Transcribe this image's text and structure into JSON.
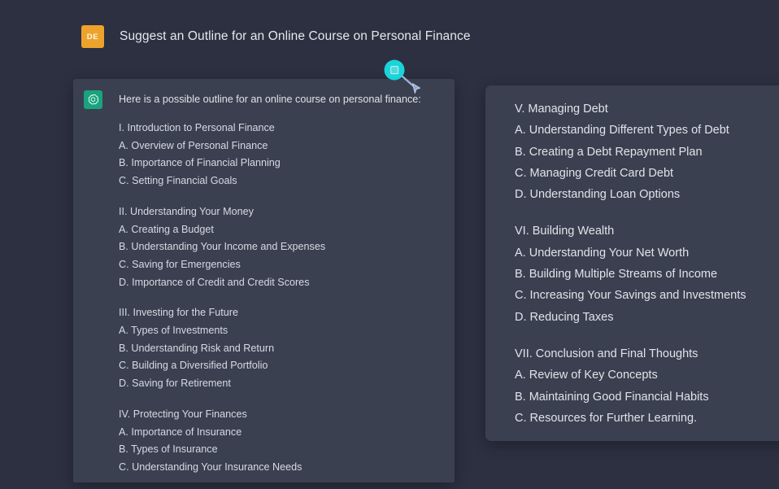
{
  "theme": {
    "background": "#2c3040",
    "panel_background": "#3b4050",
    "avatar_color": "#eda32b",
    "assistant_logo_color": "#19a37e",
    "text_color": "#d6dae3",
    "cursor_accent": "#19d4d9"
  },
  "header": {
    "avatar_initials": "DE",
    "prompt_title": "Suggest an Outline for an Online Course on Personal Finance"
  },
  "left_panel": {
    "assistant_intro": "Here is a possible outline for an online course on personal finance:",
    "groups": [
      {
        "lines": [
          "I. Introduction to Personal Finance",
          "A. Overview of Personal Finance",
          "B. Importance of Financial Planning",
          "C. Setting Financial Goals"
        ]
      },
      {
        "lines": [
          "II. Understanding Your Money",
          "A. Creating a Budget",
          "B. Understanding Your Income and Expenses",
          "C. Saving for Emergencies",
          "D. Importance of Credit and Credit Scores"
        ]
      },
      {
        "lines": [
          "III. Investing for the Future",
          "A. Types of Investments",
          "B. Understanding Risk and Return",
          "C. Building a Diversified Portfolio",
          "D. Saving for Retirement"
        ]
      },
      {
        "lines": [
          "IV. Protecting Your Finances",
          "A. Importance of Insurance",
          "B. Types of Insurance",
          "C. Understanding Your Insurance Needs"
        ]
      }
    ]
  },
  "right_panel": {
    "groups": [
      {
        "lines": [
          "V. Managing Debt",
          "A. Understanding Different Types of Debt",
          "B. Creating a Debt Repayment Plan",
          "C. Managing Credit Card Debt",
          "D. Understanding Loan Options"
        ]
      },
      {
        "lines": [
          "VI. Building Wealth",
          "A. Understanding Your Net Worth",
          "B. Building Multiple Streams of Income",
          "C. Increasing Your Savings and Investments",
          "D. Reducing Taxes"
        ]
      },
      {
        "lines": [
          "VII. Conclusion and Final Thoughts",
          "A. Review of Key Concepts",
          "B. Maintaining Good Financial Habits",
          "C. Resources for Further Learning."
        ]
      }
    ]
  },
  "annotation": {
    "icon": "cursor-pointer-icon",
    "badge_color": "#19d4d9"
  }
}
